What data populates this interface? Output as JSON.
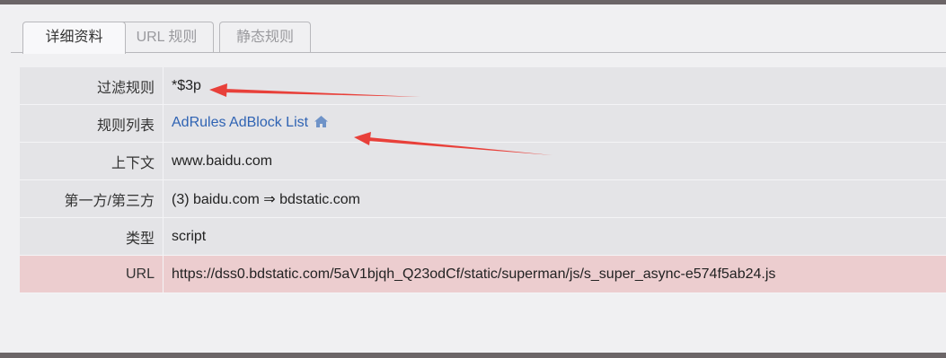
{
  "tabs": [
    {
      "label": "详细资料",
      "active": true
    },
    {
      "label": "URL 规则",
      "active": false
    },
    {
      "label": "静态规则",
      "active": false
    }
  ],
  "details": {
    "filter_rule": {
      "label": "过滤规则",
      "value": "*$3p"
    },
    "rule_list": {
      "label": "规则列表",
      "value": "AdRules AdBlock List",
      "icon": "home-icon"
    },
    "context": {
      "label": "上下文",
      "value": "www.baidu.com"
    },
    "party": {
      "label": "第一方/第三方",
      "value": "(3)  baidu.com ⇒ bdstatic.com"
    },
    "type": {
      "label": "类型",
      "value": "script"
    },
    "url": {
      "label": "URL",
      "value": "https://dss0.bdstatic.com/5aV1bjqh_Q23odCf/static/superman/js/s_super_async-e574f5ab24.js"
    }
  },
  "colors": {
    "accent_link": "#2f63b3",
    "annotation_arrow": "#e8403a",
    "url_row_bg": "#eccdcf"
  }
}
